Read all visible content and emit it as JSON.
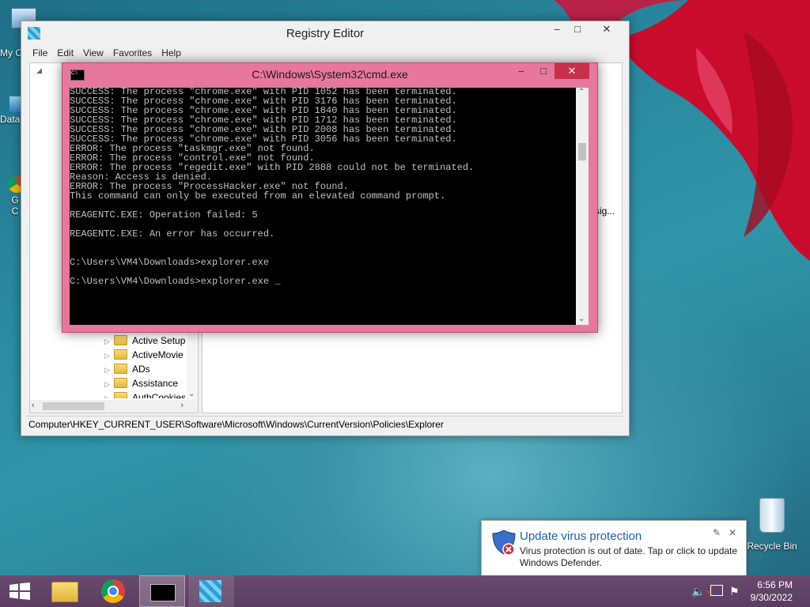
{
  "desktop": {
    "icons": [
      {
        "label": "My C",
        "name": "my-computer"
      },
      {
        "label": "Data",
        "name": "data"
      },
      {
        "label": "G",
        "name": "google-chrome-a"
      },
      {
        "label": "C",
        "name": "google-chrome-b"
      },
      {
        "label": "Recycle Bin",
        "name": "recycle-bin"
      }
    ]
  },
  "regedit": {
    "title": "Registry Editor",
    "menu": [
      "File",
      "Edit",
      "View",
      "Favorites",
      "Help"
    ],
    "tree_items": [
      "Active Setup",
      "ActiveMovie",
      "ADs",
      "Assistance",
      "AuthCookies"
    ],
    "list_fragment": "sig...",
    "status": "Computer\\HKEY_CURRENT_USER\\Software\\Microsoft\\Windows\\CurrentVersion\\Policies\\Explorer"
  },
  "cmd": {
    "title": "C:\\Windows\\System32\\cmd.exe",
    "icon_text": "C:\\",
    "lines": [
      "SUCCESS: The process \"chrome.exe\" with PID 1052 has been terminated.",
      "SUCCESS: The process \"chrome.exe\" with PID 3176 has been terminated.",
      "SUCCESS: The process \"chrome.exe\" with PID 1840 has been terminated.",
      "SUCCESS: The process \"chrome.exe\" with PID 1712 has been terminated.",
      "SUCCESS: The process \"chrome.exe\" with PID 2008 has been terminated.",
      "SUCCESS: The process \"chrome.exe\" with PID 3056 has been terminated.",
      "ERROR: The process \"taskmgr.exe\" not found.",
      "ERROR: The process \"control.exe\" not found.",
      "ERROR: The process \"regedit.exe\" with PID 2888 could not be terminated.",
      "Reason: Access is denied.",
      "ERROR: The process \"ProcessHacker.exe\" not found.",
      "This command can only be executed from an elevated command prompt.",
      "",
      "REAGENTC.EXE: Operation failed: 5",
      "",
      "REAGENTC.EXE: An error has occurred.",
      "",
      "",
      "C:\\Users\\VM4\\Downloads>explorer.exe",
      "",
      "C:\\Users\\VM4\\Downloads>explorer.exe _"
    ]
  },
  "toast": {
    "title": "Update virus protection",
    "body": "Virus protection is out of date. Tap or click to update Windows Defender."
  },
  "taskbar": {
    "time": "6:56 PM",
    "date": "9/30/2022",
    "buttons": [
      "start",
      "file-explorer",
      "chrome",
      "cmd",
      "regedit"
    ]
  },
  "colors": {
    "cmd_frame": "#e8779e",
    "taskbar": "#5a3d60",
    "toast_title": "#1a5fb4"
  }
}
